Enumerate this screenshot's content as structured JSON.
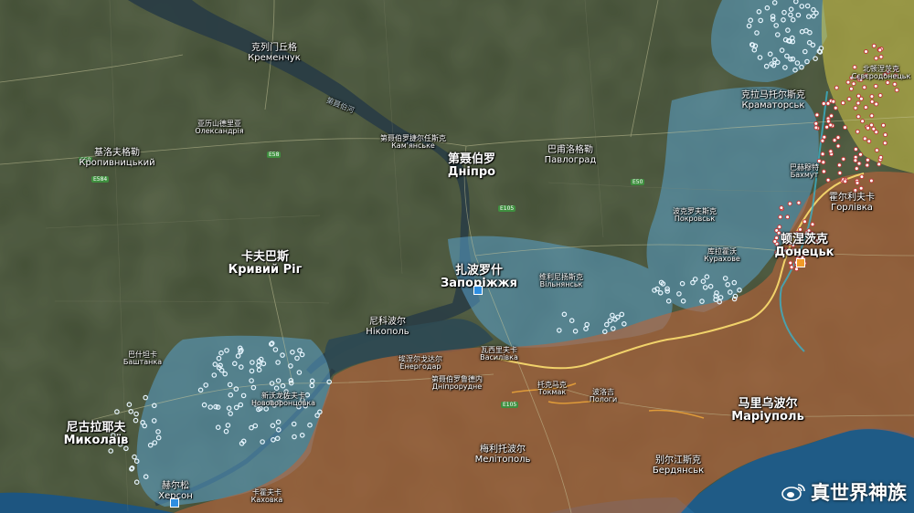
{
  "colors": {
    "terrain": "#3e4a33",
    "river": "#2c4048",
    "sea": "#1f5b86",
    "ukraine_regained": "#5aa5d2",
    "russia_occupied": "#b9643a",
    "contested": "#e0d24a",
    "frontline": "#f1d26a",
    "attack_point": "#ffffff"
  },
  "cities": [
    {
      "id": "kremenchuk",
      "zh": "克列门丘格",
      "ua": "Кременчук",
      "size": "md"
    },
    {
      "id": "kropyvnytskyi",
      "zh": "基洛夫格勒",
      "ua": "Кропивницький",
      "size": "md"
    },
    {
      "id": "oleksandriia",
      "zh": "亚历山德里亚",
      "ua": "Олександрія",
      "size": "sm"
    },
    {
      "id": "kamianske",
      "zh": "第聂伯罗捷尔任斯克",
      "ua": "Кам'янське",
      "size": "sm"
    },
    {
      "id": "dnipro",
      "zh": "第聂伯罗",
      "ua": "Дніпро",
      "size": "lg"
    },
    {
      "id": "pavlohrad",
      "zh": "巴甫洛格勒",
      "ua": "Павлоград",
      "size": "md"
    },
    {
      "id": "kramatorsk",
      "zh": "克拉马托尔斯克",
      "ua": "Краматорськ",
      "size": "md"
    },
    {
      "id": "kryvyi_rih",
      "zh": "卡夫巴斯",
      "ua": "Кривий Ріг",
      "size": "lg"
    },
    {
      "id": "zaporizhzhia",
      "zh": "扎波罗什",
      "ua": "Запоріжжя",
      "size": "lg"
    },
    {
      "id": "nikopol",
      "zh": "尼科波尔",
      "ua": "Нікополь",
      "size": "md"
    },
    {
      "id": "mykolaiv",
      "zh": "尼古拉耶夫",
      "ua": "Миколаїв",
      "size": "lg"
    },
    {
      "id": "kherson",
      "zh": "赫尔松",
      "ua": "Херсон",
      "size": "md"
    },
    {
      "id": "melitopol",
      "zh": "梅利托波尔",
      "ua": "Мелітополь",
      "size": "md"
    },
    {
      "id": "mariupol",
      "zh": "马里乌波尔",
      "ua": "Маріуполь",
      "size": "lg"
    },
    {
      "id": "berdiansk",
      "zh": "别尔江斯克",
      "ua": "Бердянськ",
      "size": "md"
    },
    {
      "id": "horlivka",
      "zh": "霍尔利夫卡",
      "ua": "Горлівка",
      "size": "md"
    },
    {
      "id": "donetsk",
      "zh": "顿涅茨克",
      "ua": "Донецьк",
      "size": "lg"
    },
    {
      "id": "sievierodonetsk",
      "zh": "北顿涅茨克",
      "ua": "Сєвєродонецьк",
      "size": "sm"
    },
    {
      "id": "vasylivka",
      "zh": "瓦西里夫卡",
      "ua": "Василівка",
      "size": "sm"
    },
    {
      "id": "tokmak",
      "zh": "托克马克",
      "ua": "Токмак",
      "size": "sm"
    },
    {
      "id": "enerhodar",
      "zh": "埃涅尔戈达尔",
      "ua": "Енергодар",
      "size": "sm"
    },
    {
      "id": "pokrovsk",
      "zh": "波克罗夫斯克",
      "ua": "Покровськ",
      "size": "sm"
    },
    {
      "id": "vilniansk",
      "zh": "维利尼扬斯克",
      "ua": "Вільнянськ",
      "size": "sm"
    },
    {
      "id": "kurakhove",
      "zh": "库拉霍沃",
      "ua": "Курахове",
      "size": "sm"
    },
    {
      "id": "novovorontsovka",
      "zh": "新沃龙佐夫卡",
      "ua": "Нововоронцовка",
      "size": "sm"
    },
    {
      "id": "bashtanka",
      "zh": "巴什坦卡",
      "ua": "Баштанка",
      "size": "sm"
    },
    {
      "id": "kakhovka",
      "zh": "卡霍夫卡",
      "ua": "Каховка",
      "size": "sm"
    },
    {
      "id": "dniprorudne",
      "zh": "第聂伯罗鲁德内",
      "ua": "Дніпрорудне",
      "size": "sm"
    },
    {
      "id": "polohy",
      "zh": "波洛吉",
      "ua": "Пологи",
      "size": "sm"
    },
    {
      "id": "bakhmut",
      "zh": "巴赫穆特",
      "ua": "Бахмут",
      "size": "sm"
    }
  ],
  "rivers": [
    {
      "id": "dnipro_river",
      "label": "第聂伯河"
    }
  ],
  "road_badges": [
    "E50",
    "E105",
    "E50",
    "E584",
    "E58",
    "E105"
  ],
  "watermark": {
    "text": "真世界神族"
  }
}
